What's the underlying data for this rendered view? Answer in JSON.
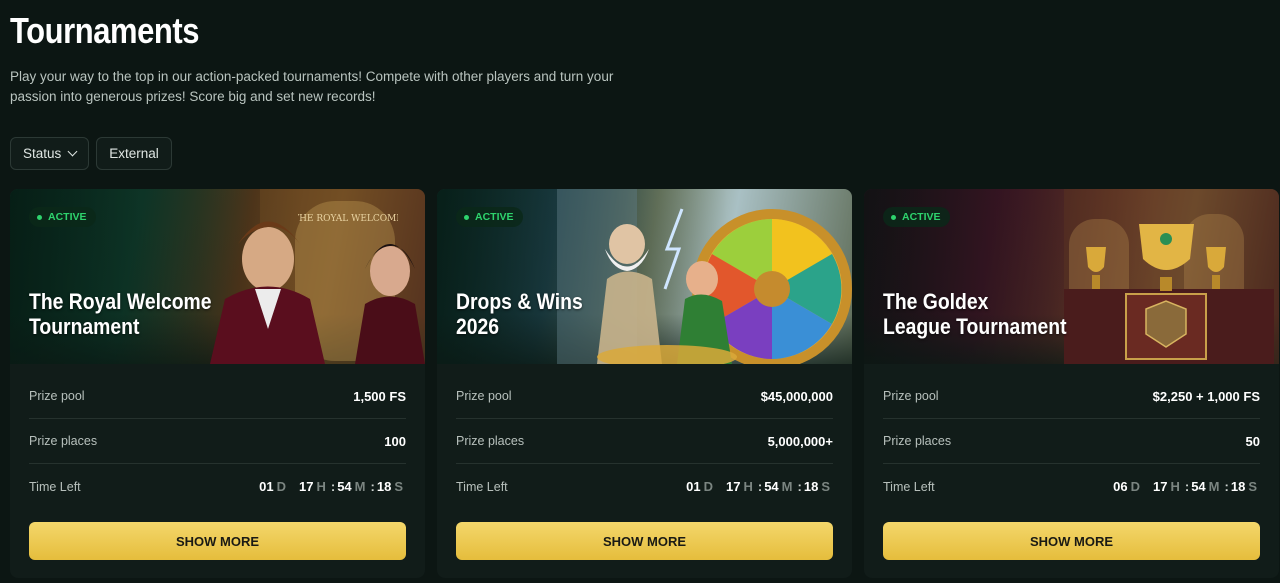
{
  "header": {
    "title": "Tournaments",
    "description": "Play your way to the top in our action-packed tournaments! Compete with other players and turn your passion into generous prizes! Score big and set new records!"
  },
  "filters": {
    "status_label": "Status",
    "external_label": "External"
  },
  "labels": {
    "prize_pool": "Prize pool",
    "prize_places": "Prize places",
    "time_left": "Time Left",
    "show_more": "SHOW MORE",
    "day_unit": "D",
    "hour_unit": "H",
    "minute_unit": "M",
    "second_unit": "S",
    "separator": ":"
  },
  "cards": [
    {
      "badge": "ACTIVE",
      "title_line1": "The Royal Welcome",
      "title_line2": "Tournament",
      "prize_pool": "1,500 FS",
      "prize_places": "100",
      "days": "01",
      "hours": "17",
      "minutes": "54",
      "seconds": "18",
      "hero_sign": "THE ROYAL WELCOME"
    },
    {
      "badge": "ACTIVE",
      "title_line1": "Drops & Wins",
      "title_line2": "2026",
      "prize_pool": "$45,000,000",
      "prize_places": "5,000,000+",
      "days": "01",
      "hours": "17",
      "minutes": "54",
      "seconds": "18"
    },
    {
      "badge": "ACTIVE",
      "title_line1": "The Goldex",
      "title_line2": "League Tournament",
      "prize_pool": "$2,250 + 1,000 FS",
      "prize_places": "50",
      "days": "06",
      "hours": "17",
      "minutes": "54",
      "seconds": "18"
    }
  ],
  "colors": {
    "background": "#0c1613",
    "card": "#111c19",
    "active_green": "#2ed36d",
    "button_gold": "#e5bd3c"
  }
}
